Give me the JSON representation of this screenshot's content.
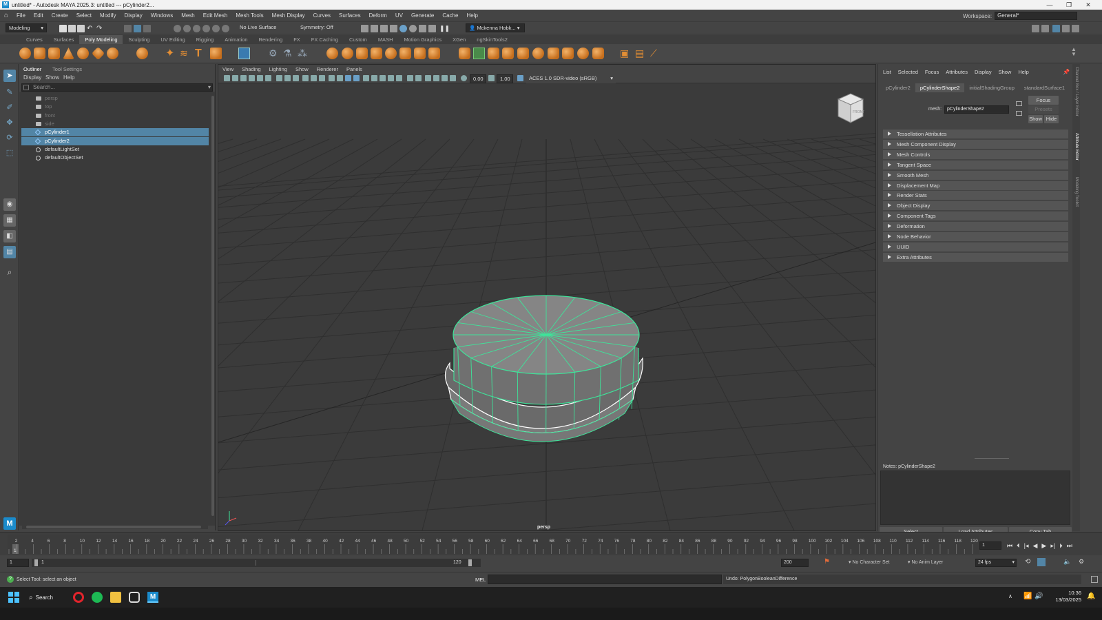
{
  "window": {
    "app_icon": "M",
    "title": "untitled* - Autodesk MAYA 2025.3: untitled   ---   pCylinder2..."
  },
  "menubar": {
    "items": [
      "File",
      "Edit",
      "Create",
      "Select",
      "Modify",
      "Display",
      "Windows",
      "Mesh",
      "Edit Mesh",
      "Mesh Tools",
      "Mesh Display",
      "Curves",
      "Surfaces",
      "Deform",
      "UV",
      "Generate",
      "Cache",
      "Help"
    ],
    "workspace_label": "Workspace:",
    "workspace_value": "General*"
  },
  "statusline": {
    "menuset": "Modeling",
    "live_surface": "No Live Surface",
    "symmetry": "Symmetry: Off",
    "user": "Mckenna Hobk..."
  },
  "shelf": {
    "tabs": [
      "Curves",
      "Surfaces",
      "Poly Modeling",
      "Sculpting",
      "UV Editing",
      "Rigging",
      "Animation",
      "Rendering",
      "FX",
      "FX Caching",
      "Custom",
      "MASH",
      "Motion Graphics",
      "XGen",
      "ngSkinTools2"
    ],
    "active_tab": "Poly Modeling"
  },
  "outliner": {
    "tabs": [
      "Outliner",
      "Tool Settings"
    ],
    "menu": [
      "Display",
      "Show",
      "Help"
    ],
    "search_placeholder": "Search...",
    "items": [
      {
        "label": "persp",
        "type": "camera",
        "dim": true,
        "selected": false
      },
      {
        "label": "top",
        "type": "camera",
        "dim": true,
        "selected": false
      },
      {
        "label": "front",
        "type": "camera",
        "dim": true,
        "selected": false
      },
      {
        "label": "side",
        "type": "camera",
        "dim": true,
        "selected": false
      },
      {
        "label": "pCylinder1",
        "type": "mesh",
        "dim": false,
        "selected": true
      },
      {
        "label": "pCylinder2",
        "type": "mesh",
        "dim": false,
        "selected": true
      },
      {
        "label": "defaultLightSet",
        "type": "set",
        "dim": false,
        "selected": false
      },
      {
        "label": "defaultObjectSet",
        "type": "set",
        "dim": false,
        "selected": false
      }
    ]
  },
  "viewport": {
    "menu": [
      "View",
      "Shading",
      "Lighting",
      "Show",
      "Renderer",
      "Panels"
    ],
    "field_a": "0.00",
    "field_b": "1.00",
    "color_space": "ACES 1.0 SDR-video (sRGB)",
    "camera_label": "persp",
    "viewcube_label": "FRONT"
  },
  "attribute_editor": {
    "menu": [
      "List",
      "Selected",
      "Focus",
      "Attributes",
      "Display",
      "Show",
      "Help"
    ],
    "node_tabs": [
      "pCylinder2",
      "pCylinderShape2",
      "initialShadingGroup",
      "standardSurface1"
    ],
    "active_tab": "pCylinderShape2",
    "mesh_label": "mesh:",
    "mesh_value": "pCylinderShape2",
    "focus_button": "Focus",
    "presets_button": "Presets",
    "show_button": "Show",
    "hide_button": "Hide",
    "sections": [
      "Tessellation Attributes",
      "Mesh Component Display",
      "Mesh Controls",
      "Tangent Space",
      "Smooth Mesh",
      "Displacement Map",
      "Render Stats",
      "Object Display",
      "Component Tags",
      "Deformation",
      "Node Behavior",
      "UUID",
      "Extra Attributes"
    ],
    "notes_label": "Notes:  pCylinderShape2",
    "bottom_buttons": [
      "Select",
      "Load Attributes",
      "Copy Tab"
    ]
  },
  "right_tabs": [
    "Channel Box / Layer Editor",
    "Attribute Editor",
    "Modeling Toolkit"
  ],
  "timeline": {
    "ticks": [
      "2",
      "4",
      "6",
      "8",
      "10",
      "12",
      "14",
      "16",
      "18",
      "20",
      "22",
      "24",
      "26",
      "28",
      "30",
      "32",
      "34",
      "36",
      "38",
      "40",
      "42",
      "44",
      "46",
      "48",
      "50",
      "52",
      "54",
      "56",
      "58",
      "60",
      "62",
      "64",
      "66",
      "68",
      "70",
      "72",
      "74",
      "76",
      "78",
      "80",
      "82",
      "84",
      "86",
      "88",
      "90",
      "92",
      "94",
      "96",
      "98",
      "100",
      "102",
      "104",
      "106",
      "108",
      "110",
      "112",
      "114",
      "116",
      "118",
      "120"
    ],
    "current_marker": "1",
    "current_frame": "1"
  },
  "range": {
    "start": "1",
    "inner_start": "1",
    "inner_end": "120",
    "end": "200",
    "character_set": "No Character Set",
    "anim_layer": "No Anim Layer",
    "fps": "24 fps"
  },
  "cmdline": {
    "help": "Select Tool: select an object",
    "mel_label": "MEL",
    "result": "Undo: PolygonBooleanDifference"
  },
  "taskbar": {
    "search": "Search",
    "time": "10:36",
    "date": "13/03/2025"
  },
  "colors": {
    "selection": "#5285a6",
    "wire": "#3ee49a",
    "maya_blue": "#1b8bcb",
    "shelf_orange": "#d8822e"
  }
}
